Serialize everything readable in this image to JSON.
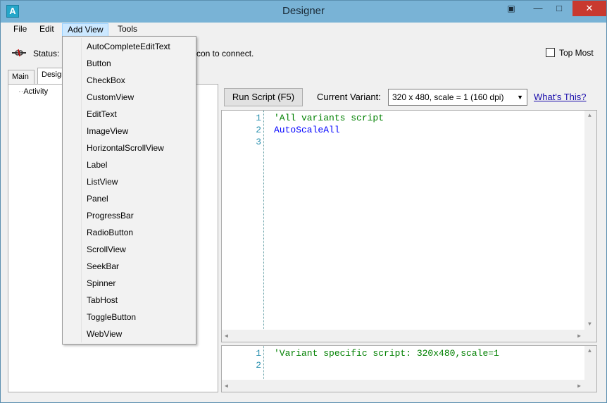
{
  "window": {
    "title": "Designer",
    "app_icon": "A"
  },
  "menubar": [
    {
      "label": "File"
    },
    {
      "label": "Edit"
    },
    {
      "label": "Add View"
    },
    {
      "label": "Tools"
    }
  ],
  "status": {
    "label": "Status:",
    "text": "con to connect."
  },
  "topmost": {
    "label": "Top Most",
    "checked": false
  },
  "tabs": {
    "main": "Main",
    "design": "Design"
  },
  "tree": {
    "item": "Activity"
  },
  "toolbar": {
    "run_label": "Run Script  (F5)",
    "variant_label": "Current Variant:",
    "variant_value": "320 x 480, scale = 1 (160 dpi)",
    "whats_this": "What's This?"
  },
  "code_top": {
    "lines": [
      {
        "num": "1",
        "text": "'All variants script"
      },
      {
        "num": "2",
        "text": "AutoScaleAll"
      },
      {
        "num": "3",
        "text": ""
      }
    ]
  },
  "code_bottom": {
    "lines": [
      {
        "num": "1",
        "text": "'Variant specific script: 320x480,scale=1"
      },
      {
        "num": "2",
        "text": ""
      }
    ]
  },
  "add_view_menu": [
    "AutoCompleteEditText",
    "Button",
    "CheckBox",
    "CustomView",
    "EditText",
    "ImageView",
    "HorizontalScrollView",
    "Label",
    "ListView",
    "Panel",
    "ProgressBar",
    "RadioButton",
    "ScrollView",
    "SeekBar",
    "Spinner",
    "TabHost",
    "ToggleButton",
    "WebView"
  ],
  "colors": {
    "titlebar": "#79b3d6",
    "close": "#c9392f",
    "link": "#1a0dab",
    "comment": "#008000",
    "keyword": "#0000ff"
  }
}
